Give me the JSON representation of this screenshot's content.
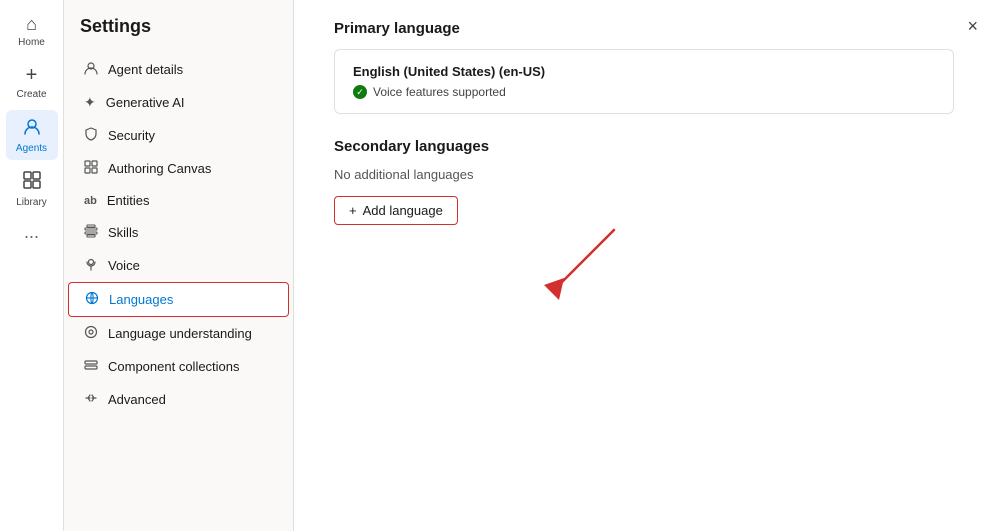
{
  "nav": {
    "items": [
      {
        "id": "home",
        "label": "Home",
        "icon": "⌂",
        "active": false
      },
      {
        "id": "create",
        "label": "Create",
        "icon": "+",
        "active": false
      },
      {
        "id": "agents",
        "label": "Agents",
        "icon": "◉",
        "active": true
      },
      {
        "id": "library",
        "label": "Library",
        "icon": "▦",
        "active": false
      }
    ],
    "more": "..."
  },
  "sidebar": {
    "title": "Settings",
    "items": [
      {
        "id": "agent-details",
        "label": "Agent details",
        "icon": "☰",
        "active": false
      },
      {
        "id": "generative-ai",
        "label": "Generative AI",
        "icon": "✦",
        "active": false
      },
      {
        "id": "security",
        "label": "Security",
        "icon": "🔒",
        "active": false
      },
      {
        "id": "authoring-canvas",
        "label": "Authoring Canvas",
        "icon": "⊞",
        "active": false
      },
      {
        "id": "entities",
        "label": "Entities",
        "icon": "ab",
        "active": false
      },
      {
        "id": "skills",
        "label": "Skills",
        "icon": "⊟",
        "active": false
      },
      {
        "id": "voice",
        "label": "Voice",
        "icon": "♟",
        "active": false
      },
      {
        "id": "languages",
        "label": "Languages",
        "icon": "⊗",
        "active": true
      },
      {
        "id": "language-understanding",
        "label": "Language understanding",
        "icon": "⊙",
        "active": false
      },
      {
        "id": "component-collections",
        "label": "Component collections",
        "icon": "⊠",
        "active": false
      },
      {
        "id": "advanced",
        "label": "Advanced",
        "icon": "⇄",
        "active": false
      }
    ]
  },
  "main": {
    "close_label": "×",
    "primary_language": {
      "section_title": "Primary language",
      "lang_name": "English (United States) (en-US)",
      "voice_label": "Voice features supported"
    },
    "secondary_languages": {
      "section_title": "Secondary languages",
      "no_langs_label": "No additional languages",
      "add_button_label": "Add language",
      "add_button_icon": "+"
    }
  }
}
